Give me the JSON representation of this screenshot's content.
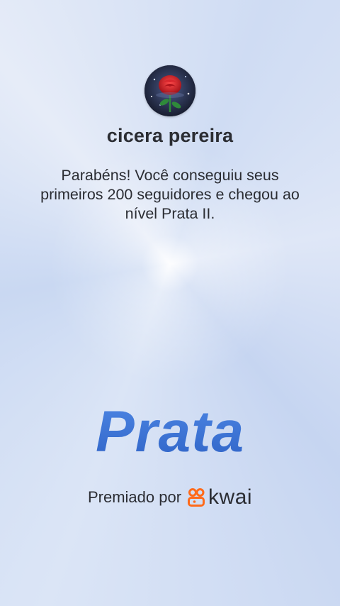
{
  "profile": {
    "avatar_icon": "rose-icon",
    "name": "cicera pereira"
  },
  "message": "Parabéns! Você conseguiu seus primeiros 200 seguidores e chegou ao nível Prata II.",
  "level": "Prata",
  "footer": {
    "awarded_label": "Premiado por",
    "brand_icon": "kwai-logo-icon",
    "brand_name": "kwai"
  },
  "colors": {
    "level_blue": "#3f77d6",
    "brand_orange": "#ff6a1a",
    "text": "#2b2d33"
  }
}
